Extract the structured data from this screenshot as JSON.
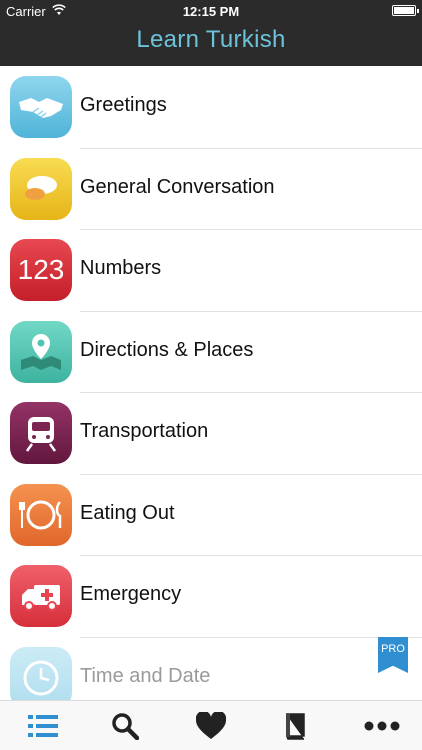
{
  "status": {
    "carrier": "Carrier",
    "time": "12:15 PM"
  },
  "header": {
    "title": "Learn Turkish"
  },
  "categories": [
    {
      "label": "Greetings",
      "icon": "handshake-icon",
      "color": "#68c4e1"
    },
    {
      "label": "General Conversation",
      "icon": "speech-bubbles-icon",
      "color": "#f2c72e"
    },
    {
      "label": "Numbers",
      "icon": "numbers-icon",
      "icon_text": "123",
      "color": "#d9323a"
    },
    {
      "label": "Directions & Places",
      "icon": "map-pin-icon",
      "color": "#4ec5b3"
    },
    {
      "label": "Transportation",
      "icon": "train-icon",
      "color": "#7c2550"
    },
    {
      "label": "Eating Out",
      "icon": "plate-icon",
      "color": "#ec7b3a"
    },
    {
      "label": "Emergency",
      "icon": "ambulance-icon",
      "color": "#e8444f"
    },
    {
      "label": "Time and Date",
      "icon": "clock-icon",
      "color": "#68c4e1"
    }
  ],
  "pro_badge": "PRO",
  "tabbar": {
    "items": [
      "list-icon",
      "search-icon",
      "heart-icon",
      "book-icon",
      "more-icon"
    ],
    "active_color": "#2f8fd0",
    "inactive_color": "#222222"
  }
}
